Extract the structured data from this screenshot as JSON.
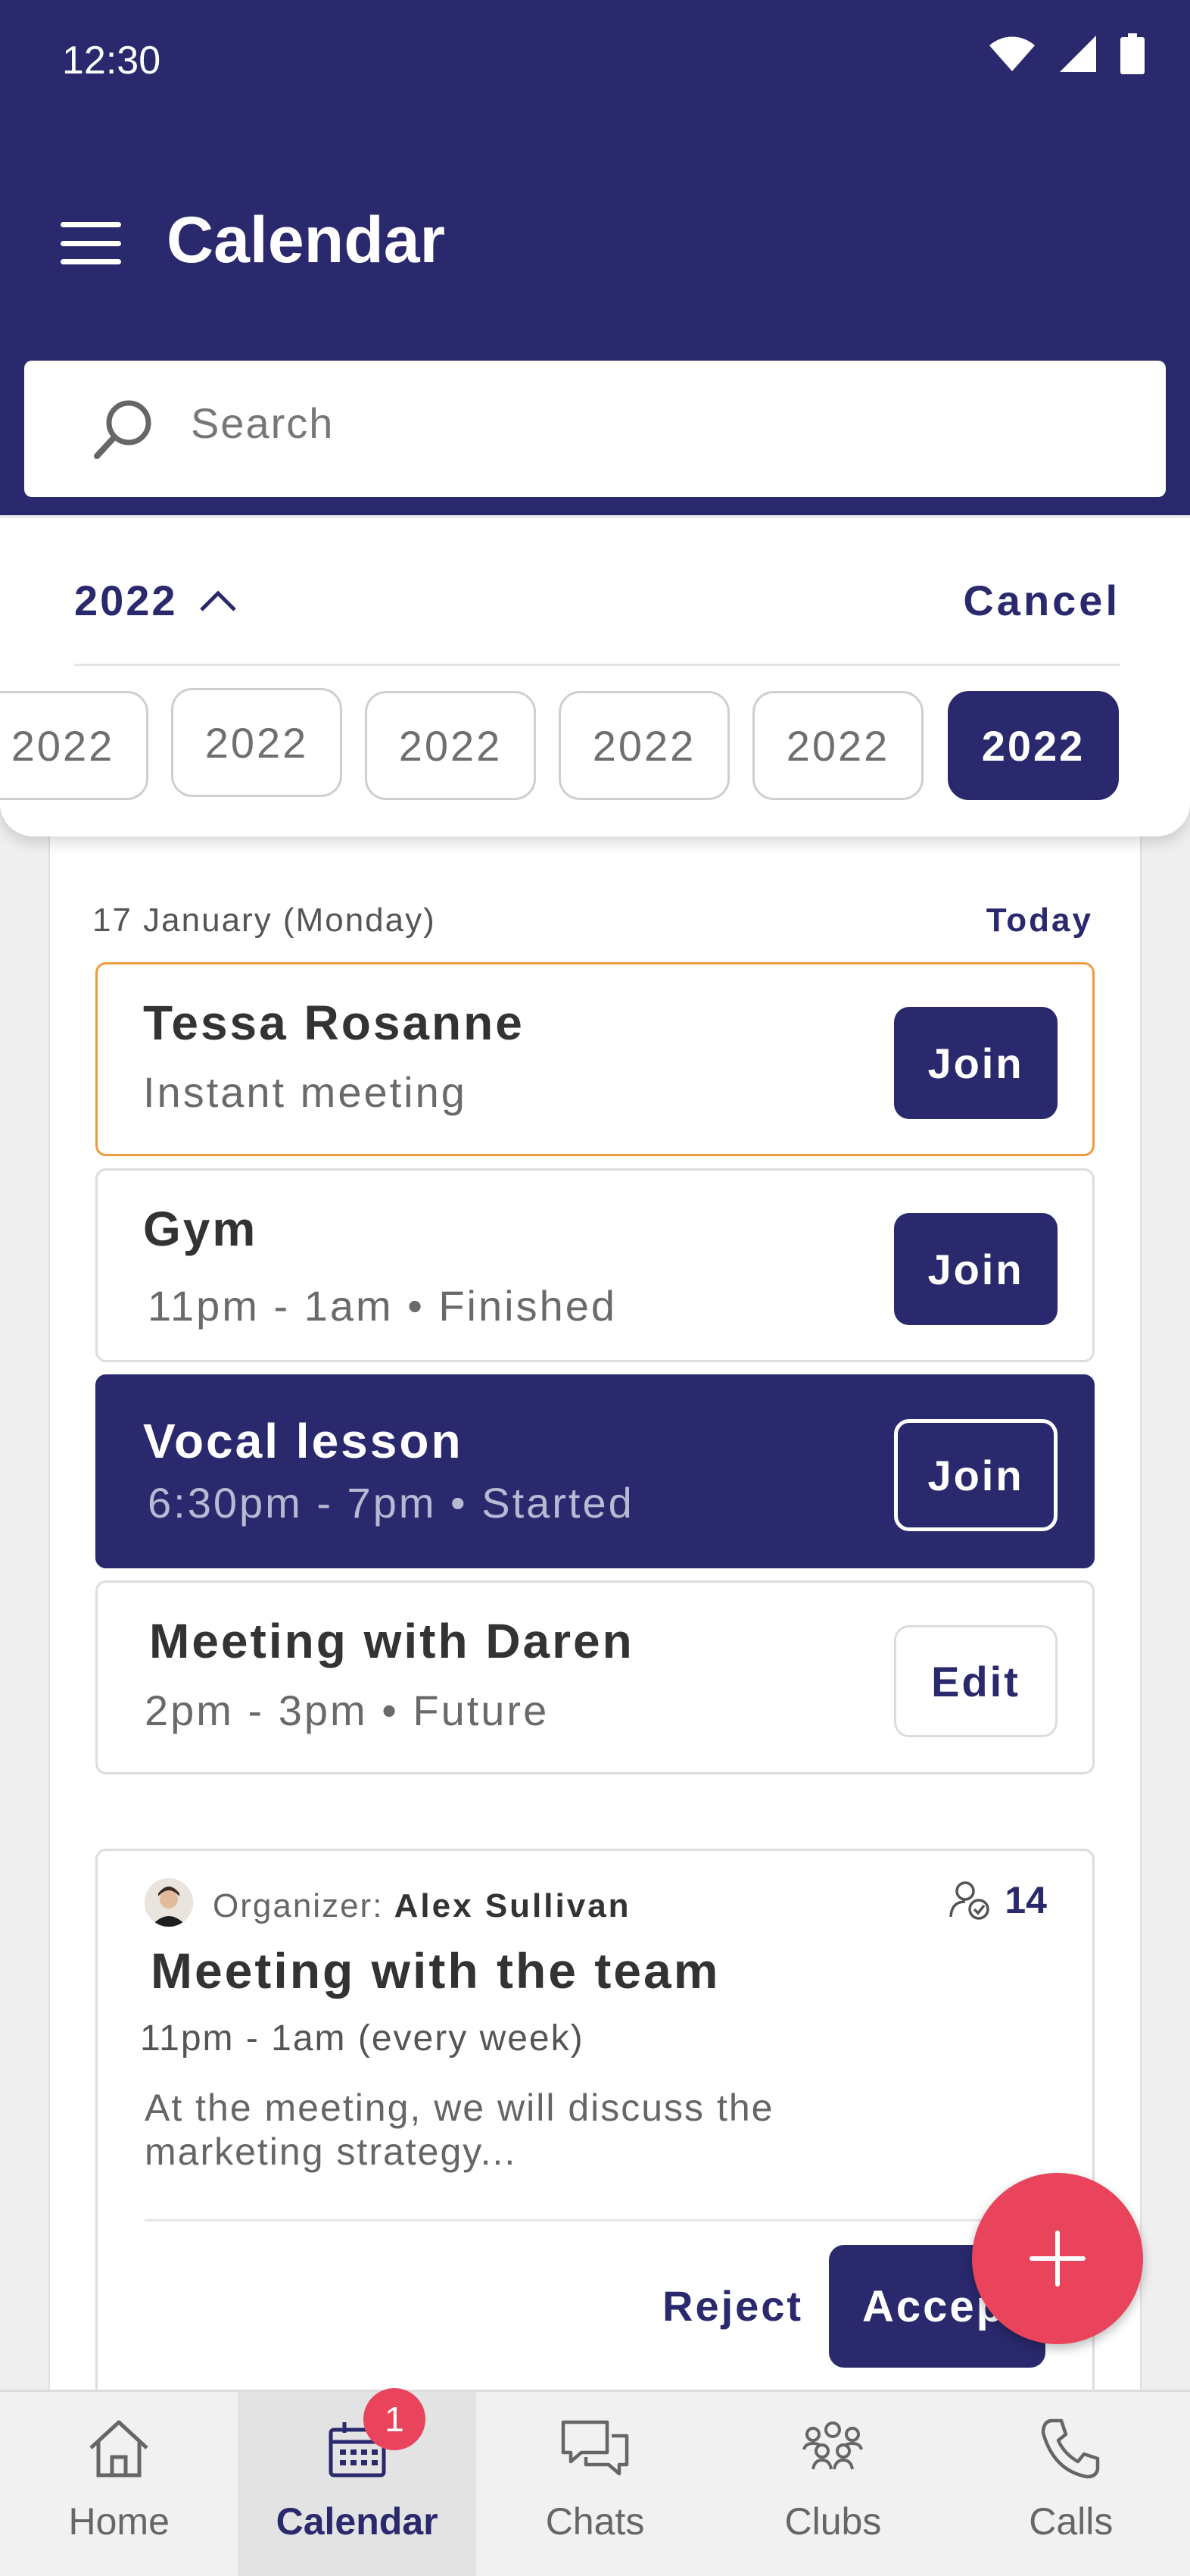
{
  "status_bar": {
    "time": "12:30"
  },
  "app_bar": {
    "title": "Calendar"
  },
  "search": {
    "placeholder": "Search"
  },
  "year_picker": {
    "current": "2022",
    "cancel_label": "Cancel",
    "years": [
      "2022",
      "2022",
      "2022",
      "2022",
      "2022",
      "2022"
    ],
    "selected_index": 5
  },
  "day": {
    "date_label": "17 January (Monday)",
    "today_label": "Today"
  },
  "events": [
    {
      "title": "Tessa Rosanne",
      "subtitle": "Instant meeting",
      "action": "Join"
    },
    {
      "title": "Gym",
      "subtitle": "11pm - 1am • Finished",
      "action": "Join"
    },
    {
      "title": "Vocal lesson",
      "subtitle": "6:30pm - 7pm • Started",
      "action": "Join"
    },
    {
      "title": "Meeting with Daren",
      "subtitle": "2pm - 3pm • Future",
      "action": "Edit"
    }
  ],
  "invitation": {
    "organizer_label": "Organizer:",
    "organizer_name": "Alex Sullivan",
    "attendee_count": "14",
    "title": "Meeting with the team",
    "time": "11pm - 1am (every week)",
    "description": "At the meeting, we will discuss the marketing strategy...",
    "reject_label": "Reject",
    "accept_label": "Accept"
  },
  "bottom_nav": {
    "items": [
      {
        "label": "Home",
        "icon": "home-icon"
      },
      {
        "label": "Calendar",
        "icon": "calendar-icon",
        "badge": "1"
      },
      {
        "label": "Chats",
        "icon": "chat-icon"
      },
      {
        "label": "Clubs",
        "icon": "group-icon"
      },
      {
        "label": "Calls",
        "icon": "phone-icon"
      }
    ],
    "active": "Calendar"
  },
  "colors": {
    "primary": "#2a296d",
    "accent_red": "#e9445b",
    "highlight_orange": "#f09a3e"
  }
}
